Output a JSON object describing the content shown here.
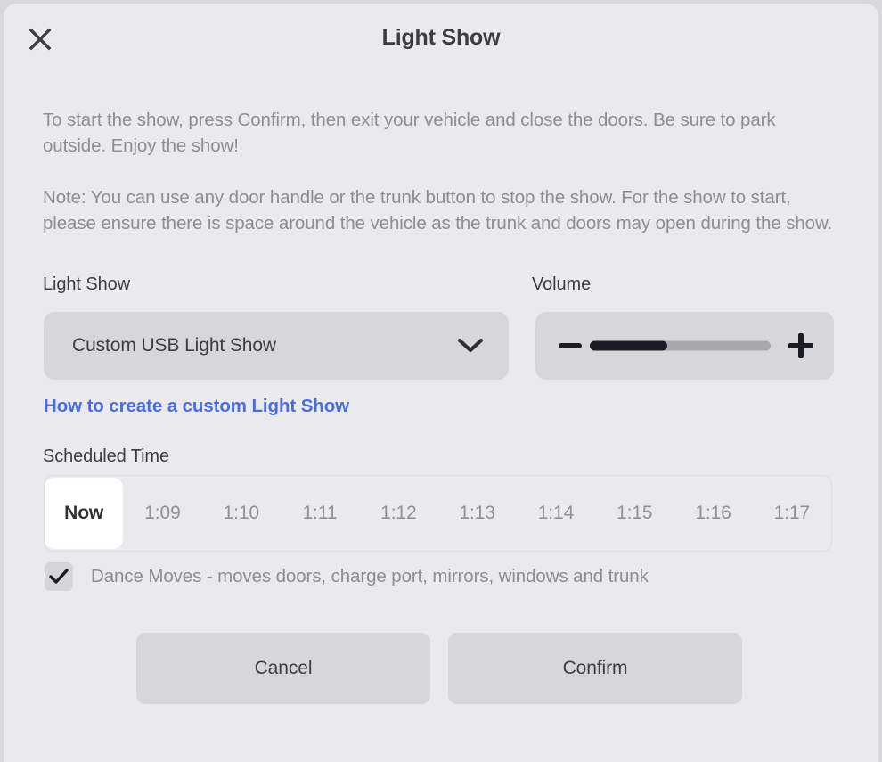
{
  "header": {
    "title": "Light Show",
    "close_icon": "close-icon"
  },
  "body": {
    "paragraph_1": "To start the show, press Confirm, then exit your vehicle and close the doors. Be sure to park outside. Enjoy the show!",
    "paragraph_2": "Note: You can use any door handle or the trunk button to stop the show. For the show to start, please ensure there is space around the vehicle as the trunk and doors may open during the show."
  },
  "light_show": {
    "label": "Light Show",
    "selected_option": "Custom USB Light Show",
    "chevron_icon": "chevron-down-icon",
    "help_link": "How to create a custom Light Show"
  },
  "volume": {
    "label": "Volume",
    "decrease_icon": "minus-icon",
    "increase_icon": "plus-icon",
    "level_percent": 43
  },
  "scheduled_time": {
    "label": "Scheduled Time",
    "selected": "Now",
    "options": [
      "Now",
      "1:09",
      "1:10",
      "1:11",
      "1:12",
      "1:13",
      "1:14",
      "1:15",
      "1:16",
      "1:17"
    ]
  },
  "dance_moves": {
    "label": "Dance Moves - moves doors, charge port, mirrors, windows and trunk",
    "checked": true,
    "check_icon": "checkmark-icon"
  },
  "footer": {
    "cancel_label": "Cancel",
    "confirm_label": "Confirm"
  },
  "colors": {
    "panel_bg": "#eaeaec",
    "control_bg": "#d7d7d9",
    "link_blue": "#4a6ee0",
    "text_dark": "#3d3d40",
    "text_muted": "#8d8d92",
    "slider_fill": "#1b1d26",
    "slider_track": "#a9a9ad"
  }
}
